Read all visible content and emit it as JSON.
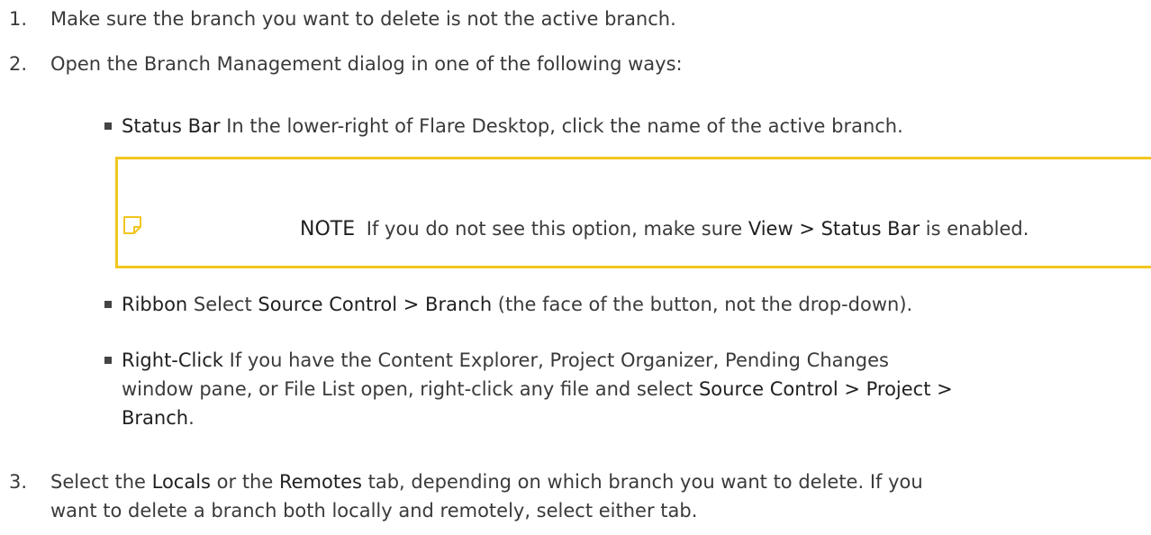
{
  "steps": [
    {
      "number": "1.",
      "text": "Make sure the branch you want to delete is not the active branch."
    },
    {
      "number": "2.",
      "text": "Open the Branch Management dialog in one of the following ways:"
    },
    {
      "number": "3.",
      "text_a": "Select the ",
      "locals": "Locals",
      "text_b": " or the ",
      "remotes": "Remotes",
      "text_c": " tab, depending on which branch you want to delete. If you",
      "text_d": "want to delete a branch both locally and remotely, select either tab."
    }
  ],
  "bullets": [
    {
      "term": "Status Bar",
      "text": " In the lower-right of Flare Desktop, click the name of the active branch."
    },
    {
      "term": "Ribbon",
      "text_a": " Select ",
      "path": "Source Control > Branch",
      "text_b": " (the face of the button, not the drop-down)."
    },
    {
      "term": "Right-Click",
      "text_a": " If you have the Content Explorer, Project Organizer, Pending Changes",
      "text_b": "window pane, or File List open, right-click any file and select ",
      "path_a": "Source Control > Project >",
      "path_b": "Branch",
      "text_c": "."
    }
  ],
  "note": {
    "icon": "note-icon",
    "label": "NOTE",
    "text_a": " If you do not see this option, make sure ",
    "path": "View > Status Bar",
    "text_b": " is enabled."
  },
  "colors": {
    "note_border": "#f2c61f",
    "text": "#3a3a3a",
    "emphasis": "#1f1f1f"
  }
}
